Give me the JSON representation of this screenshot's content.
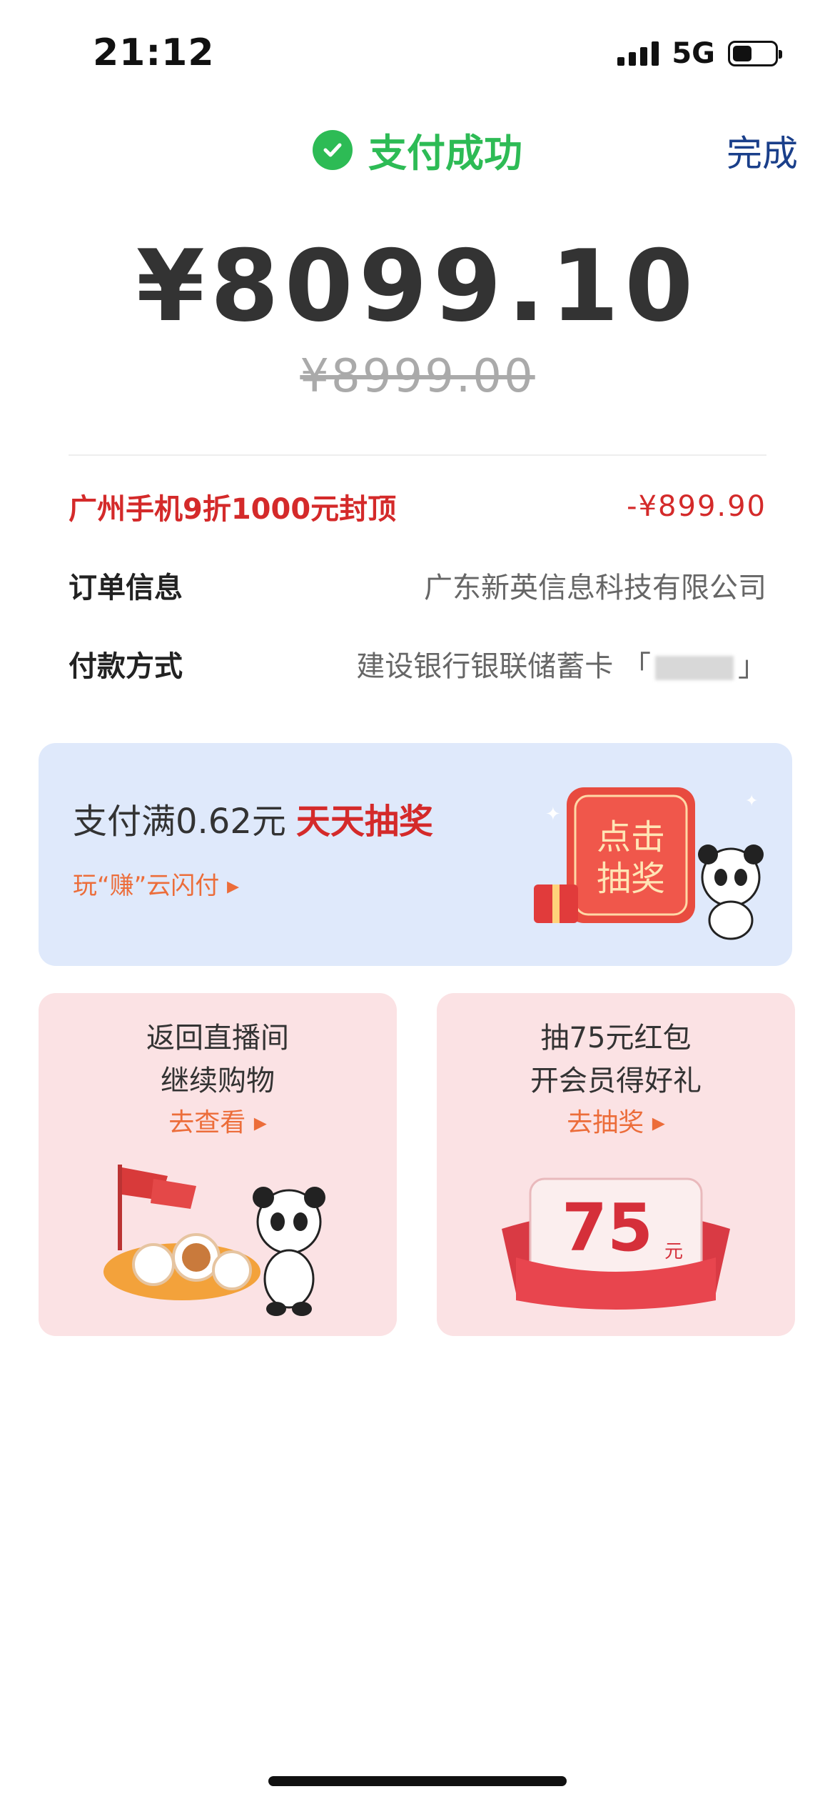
{
  "status_bar": {
    "time": "21:12",
    "network": "5G"
  },
  "header": {
    "status": "支付成功",
    "done_label": "完成"
  },
  "payment": {
    "amount": "¥8099.10",
    "original_amount": "¥8999.00"
  },
  "details": {
    "discount": {
      "label": "广州手机9折1000元封顶",
      "value": "-¥899.90"
    },
    "order": {
      "label": "订单信息",
      "value": "广东新英信息科技有限公司"
    },
    "method": {
      "label": "付款方式",
      "value": "建设银行银联储蓄卡"
    }
  },
  "lottery_banner": {
    "title": "支付满0.62元",
    "highlight": "天天抽奖",
    "subtitle": "玩“赚”云闪付",
    "button_line1": "点击",
    "button_line2": "抽奖"
  },
  "cards": [
    {
      "line1": "返回直播间",
      "line2": "继续购物",
      "action": "去查看"
    },
    {
      "line1": "抽75元红包",
      "line2": "开会员得好礼",
      "action": "去抽奖",
      "amount": "75",
      "unit": "元"
    }
  ],
  "colors": {
    "success": "#2dbb55",
    "discount": "#d42a2a",
    "accent": "#ec6d3a",
    "link": "#1a3f8a"
  }
}
